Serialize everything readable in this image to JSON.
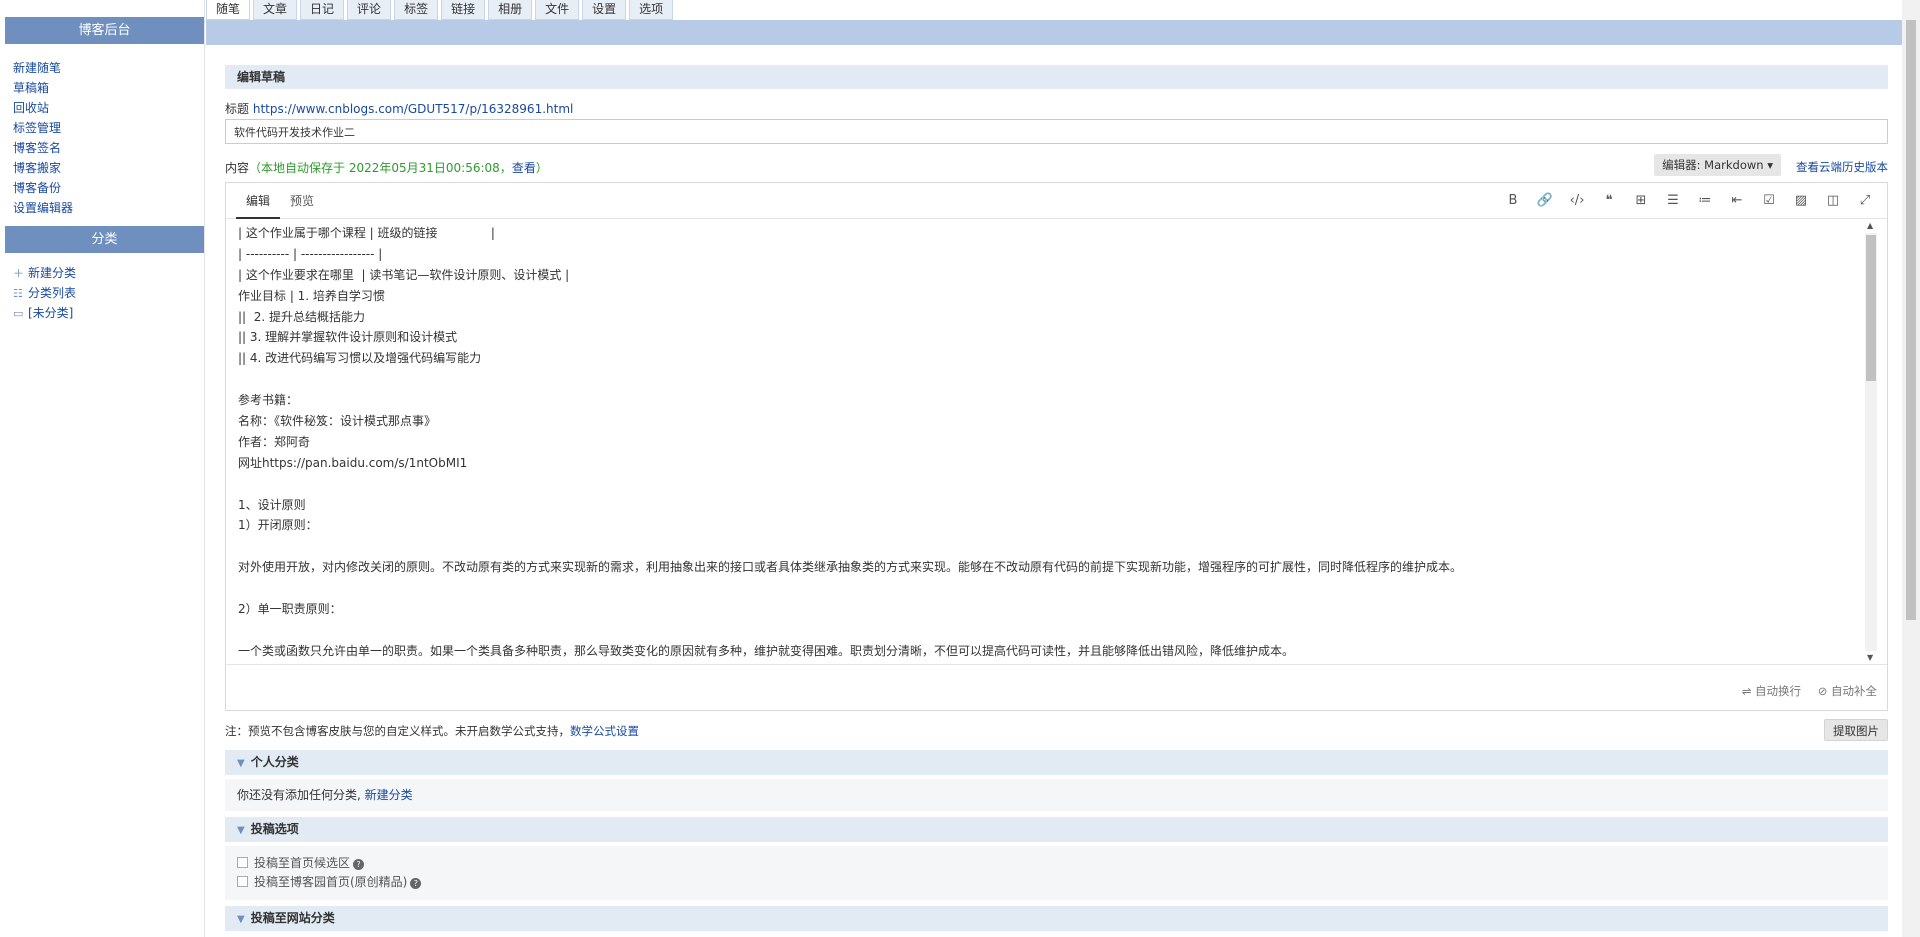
{
  "sidebar": {
    "header": "博客后台",
    "links": [
      "新建随笔",
      "草稿箱",
      "回收站",
      "标签管理",
      "博客签名",
      "博客搬家",
      "博客备份",
      "设置编辑器"
    ],
    "category_header": "分类",
    "categories": [
      {
        "icon": "plus-icon",
        "label": "新建分类"
      },
      {
        "icon": "list-icon",
        "label": "分类列表"
      },
      {
        "icon": "folder-icon",
        "label": "[未分类]"
      }
    ]
  },
  "tabs": [
    "随笔",
    "文章",
    "日记",
    "评论",
    "标签",
    "链接",
    "相册",
    "文件",
    "设置",
    "选项"
  ],
  "active_tab": "随笔",
  "edit": {
    "section_title": "编辑草稿",
    "title_label": "标题",
    "title_url": "https://www.cnblogs.com/GDUT517/p/16328961.html",
    "title_value": "软件代码开发技术作业二",
    "content_label": "内容",
    "autosave_text": "（本地自动保存于 2022年05月31日00:56:08，",
    "autosave_view": "查看",
    "autosave_close": "）",
    "editor_select": "编辑器: Markdown ▾",
    "history_link": "查看云端历史版本"
  },
  "editor": {
    "tabs": [
      "编辑",
      "预览"
    ],
    "toolbar_icons": [
      "bold-icon",
      "link-icon",
      "code-icon",
      "quote-icon",
      "table-icon",
      "bullet-list-icon",
      "numbered-list-icon",
      "indent-icon",
      "checkbox-icon",
      "image-icon",
      "split-view-icon",
      "fullscreen-icon"
    ],
    "toolbar_glyphs": [
      "B",
      "🔗",
      "‹/›",
      "❝",
      "⊞",
      "☰",
      "≔",
      "⇤",
      "☑",
      "▨",
      "◫",
      "⤢"
    ],
    "lines": [
      "| 这个作业属于哪个课程 | 班级的链接              |",
      "| ---------- | ----------------- |",
      "| 这个作业要求在哪里  | 读书笔记—软件设计原则、设计模式 |",
      "作业目标 | 1. 培养自学习惯",
      "||  2. 提升总结概括能力",
      "|| 3. 理解并掌握软件设计原则和设计模式",
      "|| 4. 改进代码编写习惯以及增强代码编写能力",
      "",
      "参考书籍：",
      "名称：《软件秘笈：设计模式那点事》",
      "作者：郑阿奇",
      "网址https://pan.baidu.com/s/1ntObMI1",
      "",
      "1、设计原则",
      "1）开闭原则：",
      "",
      "对外使用开放，对内修改关闭的原则。不改动原有类的方式来实现新的需求，利用抽象出来的接口或者具体类继承抽象类的方式来实现。能够在不改动原有代码的前提下实现新功能，增强程序的可扩展性，同时降低程序的维护成本。",
      "",
      "2）单一职责原则：",
      "",
      "一个类或函数只允许由单一的职责。如果一个类具备多种职责，那么导致类变化的原因就有多种，维护就变得困难。职责划分清晰，不但可以提高代码可读性，并且能够降低出错风险，降低维护成本。"
    ],
    "footer_wrap": "自动换行",
    "footer_complete": "自动补全"
  },
  "note": {
    "text": "注：预览不包含博客皮肤与您的自定义样式。未开启数学公式支持，",
    "link": "数学公式设置",
    "extract_button": "提取图片"
  },
  "personal_category": {
    "title": "个人分类",
    "text": "你还没有添加任何分类,",
    "link": "新建分类"
  },
  "submit_options": {
    "title": "投稿选项",
    "options": [
      "投稿至首页候选区",
      "投稿至博客园首页(原创精品)"
    ]
  },
  "site_category": {
    "title": "投稿至网站分类"
  }
}
